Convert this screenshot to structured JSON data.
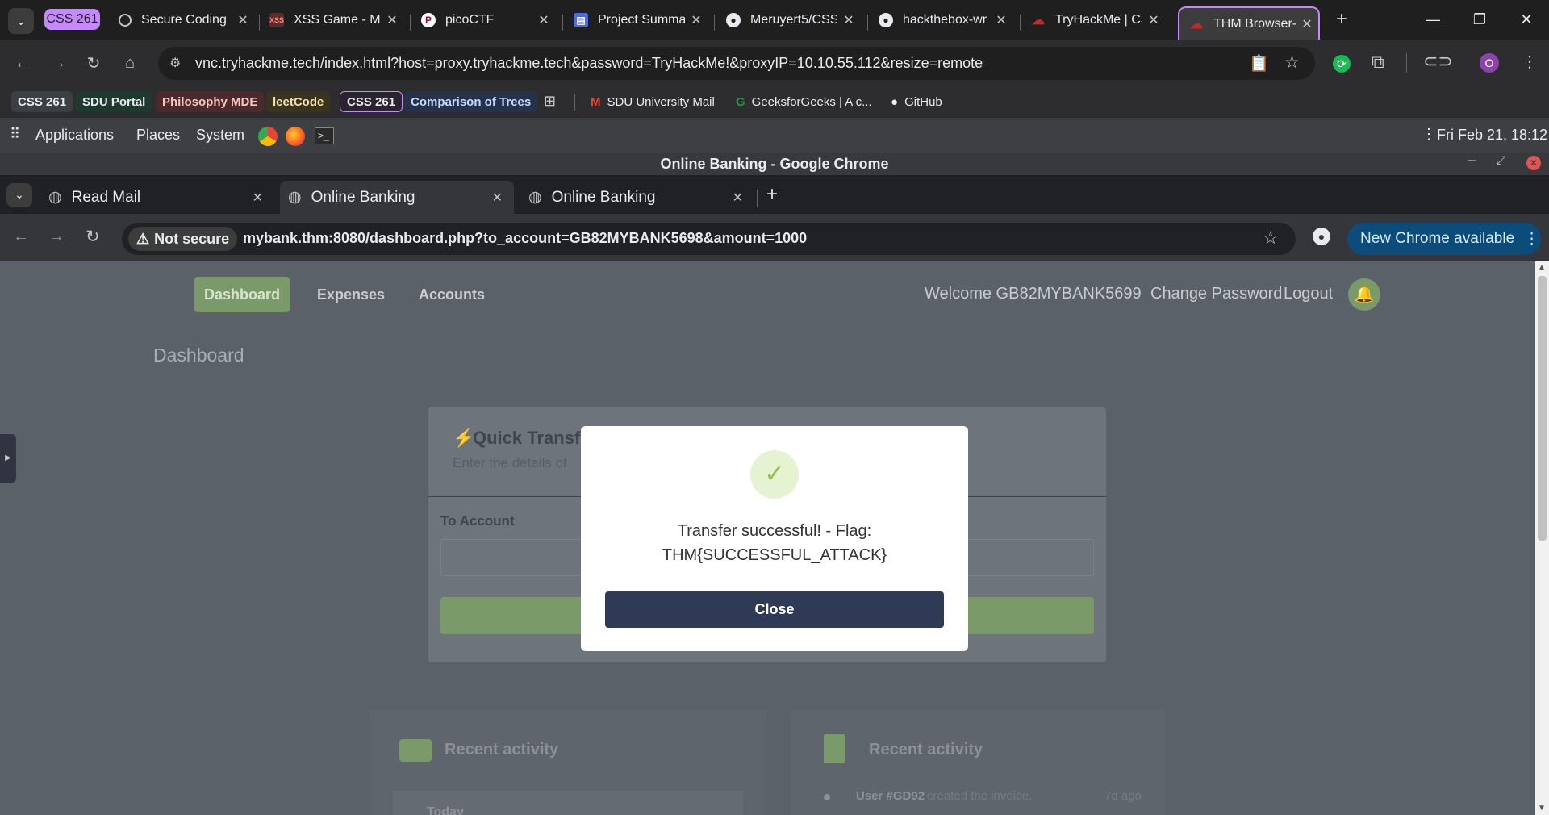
{
  "outer_browser": {
    "tabs": [
      {
        "title": "CSS 261",
        "badge": true
      },
      {
        "title": "Secure Coding"
      },
      {
        "title": "XSS Game - Ma"
      },
      {
        "title": "picoCTF"
      },
      {
        "title": "Project Summa"
      },
      {
        "title": "Meruyert5/CSS"
      },
      {
        "title": "hackthebox-wr"
      },
      {
        "title": "TryHackMe | CS"
      },
      {
        "title": "THM Browser-E",
        "active": true
      }
    ],
    "url": "vnc.tryhackme.tech/index.html?host=proxy.tryhackme.tech&password=TryHackMe!&proxyIP=10.10.55.112&resize=remote",
    "profile_initial": "O",
    "bookmarks": [
      {
        "label": "CSS 261",
        "color": "#3c4043"
      },
      {
        "label": "SDU Portal",
        "color": "#1e3a2e"
      },
      {
        "label": "Philosophy MDE",
        "color": "#4a2a2a"
      },
      {
        "label": "leetCode",
        "color": "#3a3320"
      },
      {
        "label": "CSS 261",
        "color": "#3a2a4a"
      },
      {
        "label": "Comparison of Trees",
        "color": "#26324a"
      }
    ],
    "bookmark_links": [
      "SDU University Mail",
      "GeeksforGeeks | A c...",
      "GitHub"
    ]
  },
  "desktop_panel": {
    "menus": [
      "Applications",
      "Places",
      "System"
    ],
    "clock": "Fri Feb 21, 18:12"
  },
  "inner_browser": {
    "window_title": "Online Banking - Google Chrome",
    "tabs": [
      {
        "title": "Read Mail"
      },
      {
        "title": "Online Banking",
        "active": true
      },
      {
        "title": "Online Banking"
      }
    ],
    "security_label": "Not secure",
    "url": "mybank.thm:8080/dashboard.php?to_account=GB82MYBANK5698&amount=1000",
    "update_button": "New Chrome available"
  },
  "bank_page": {
    "nav": [
      "Dashboard",
      "Expenses",
      "Accounts"
    ],
    "welcome": "Welcome GB82MYBANK5699",
    "change_password": "Change Password",
    "logout": "Logout",
    "heading": "Dashboard",
    "quick_transfer_title": "Quick Transfer",
    "quick_transfer_subtitle": "Enter the details of",
    "to_account_label": "To Account",
    "recent_activity_1": "Recent activity",
    "recent_activity_2": "Recent activity",
    "today_label": "Today",
    "activity_user": "User #GD92",
    "activity_text": "created the invoice.",
    "activity_time": "7d ago"
  },
  "modal": {
    "message_line1": "Transfer successful! - Flag:",
    "message_line2": "THM{SUCCESSFUL_ATTACK}",
    "close_label": "Close"
  },
  "colors": {
    "accent_purple": "#c58af9",
    "success_green": "#8bc34a",
    "modal_button": "#2f3a56",
    "update_button": "#0b4c7a"
  }
}
